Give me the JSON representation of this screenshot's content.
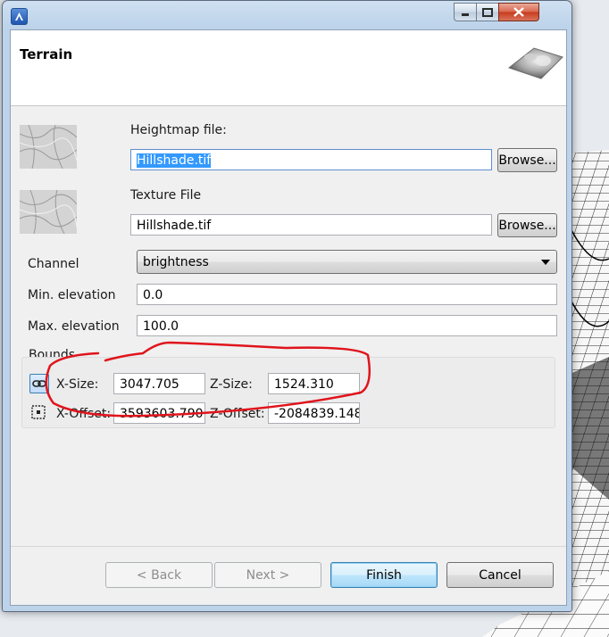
{
  "window": {
    "app_icon": "app-logo-icon",
    "controls": {
      "minimize_icon": "minimize-icon",
      "maximize_icon": "maximize-icon",
      "close_icon": "close-icon"
    }
  },
  "header": {
    "title": "Terrain",
    "image": "terrain-preview-icon"
  },
  "form": {
    "heightmap": {
      "label": "Heightmap file:",
      "value": "Hillshade.tif",
      "browse_label": "Browse..."
    },
    "texture": {
      "label": "Texture File",
      "value": "Hillshade.tif",
      "browse_label": "Browse..."
    },
    "channel": {
      "label": "Channel",
      "selected": "brightness"
    },
    "min_elevation": {
      "label": "Min. elevation",
      "value": "0.0"
    },
    "max_elevation": {
      "label": "Max. elevation",
      "value": "100.0"
    },
    "bounds": {
      "label": "Bounds",
      "link_icon": "link-icon",
      "grid_icon": "grid-icon",
      "x_size_label": "X-Size:",
      "x_size": "3047.705",
      "z_size_label": "Z-Size:",
      "z_size": "1524.310",
      "x_offset_label": "X-Offset:",
      "x_offset": "3593603.790",
      "z_offset_label": "Z-Offset:",
      "z_offset": "-2084839.148"
    }
  },
  "footer": {
    "back": "< Back",
    "next": "Next >",
    "finish": "Finish",
    "cancel": "Cancel"
  },
  "colors": {
    "annotation": "#e0141c",
    "selection": "#3399ff",
    "accent": "#3c7fb1"
  }
}
